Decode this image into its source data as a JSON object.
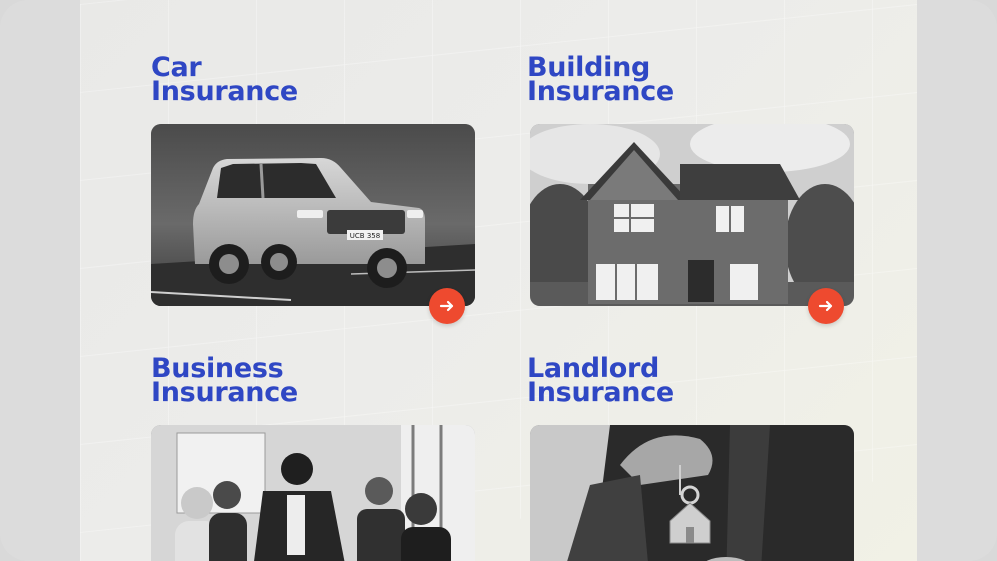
{
  "cards": [
    {
      "title_line1": "Car",
      "title_line2": "Insurance",
      "image": "car-photo",
      "plate": "UCB 358"
    },
    {
      "title_line1": "Building",
      "title_line2": "Insurance",
      "image": "house-photo"
    },
    {
      "title_line1": "Business",
      "title_line2": "Insurance",
      "image": "business-meeting-photo"
    },
    {
      "title_line1": "Landlord",
      "title_line2": "Insurance",
      "image": "keys-handover-photo"
    }
  ],
  "colors": {
    "title": "#2f47c4",
    "arrow_button": "#ee4a2f"
  },
  "icons": {
    "arrow": "arrow-right-icon"
  }
}
